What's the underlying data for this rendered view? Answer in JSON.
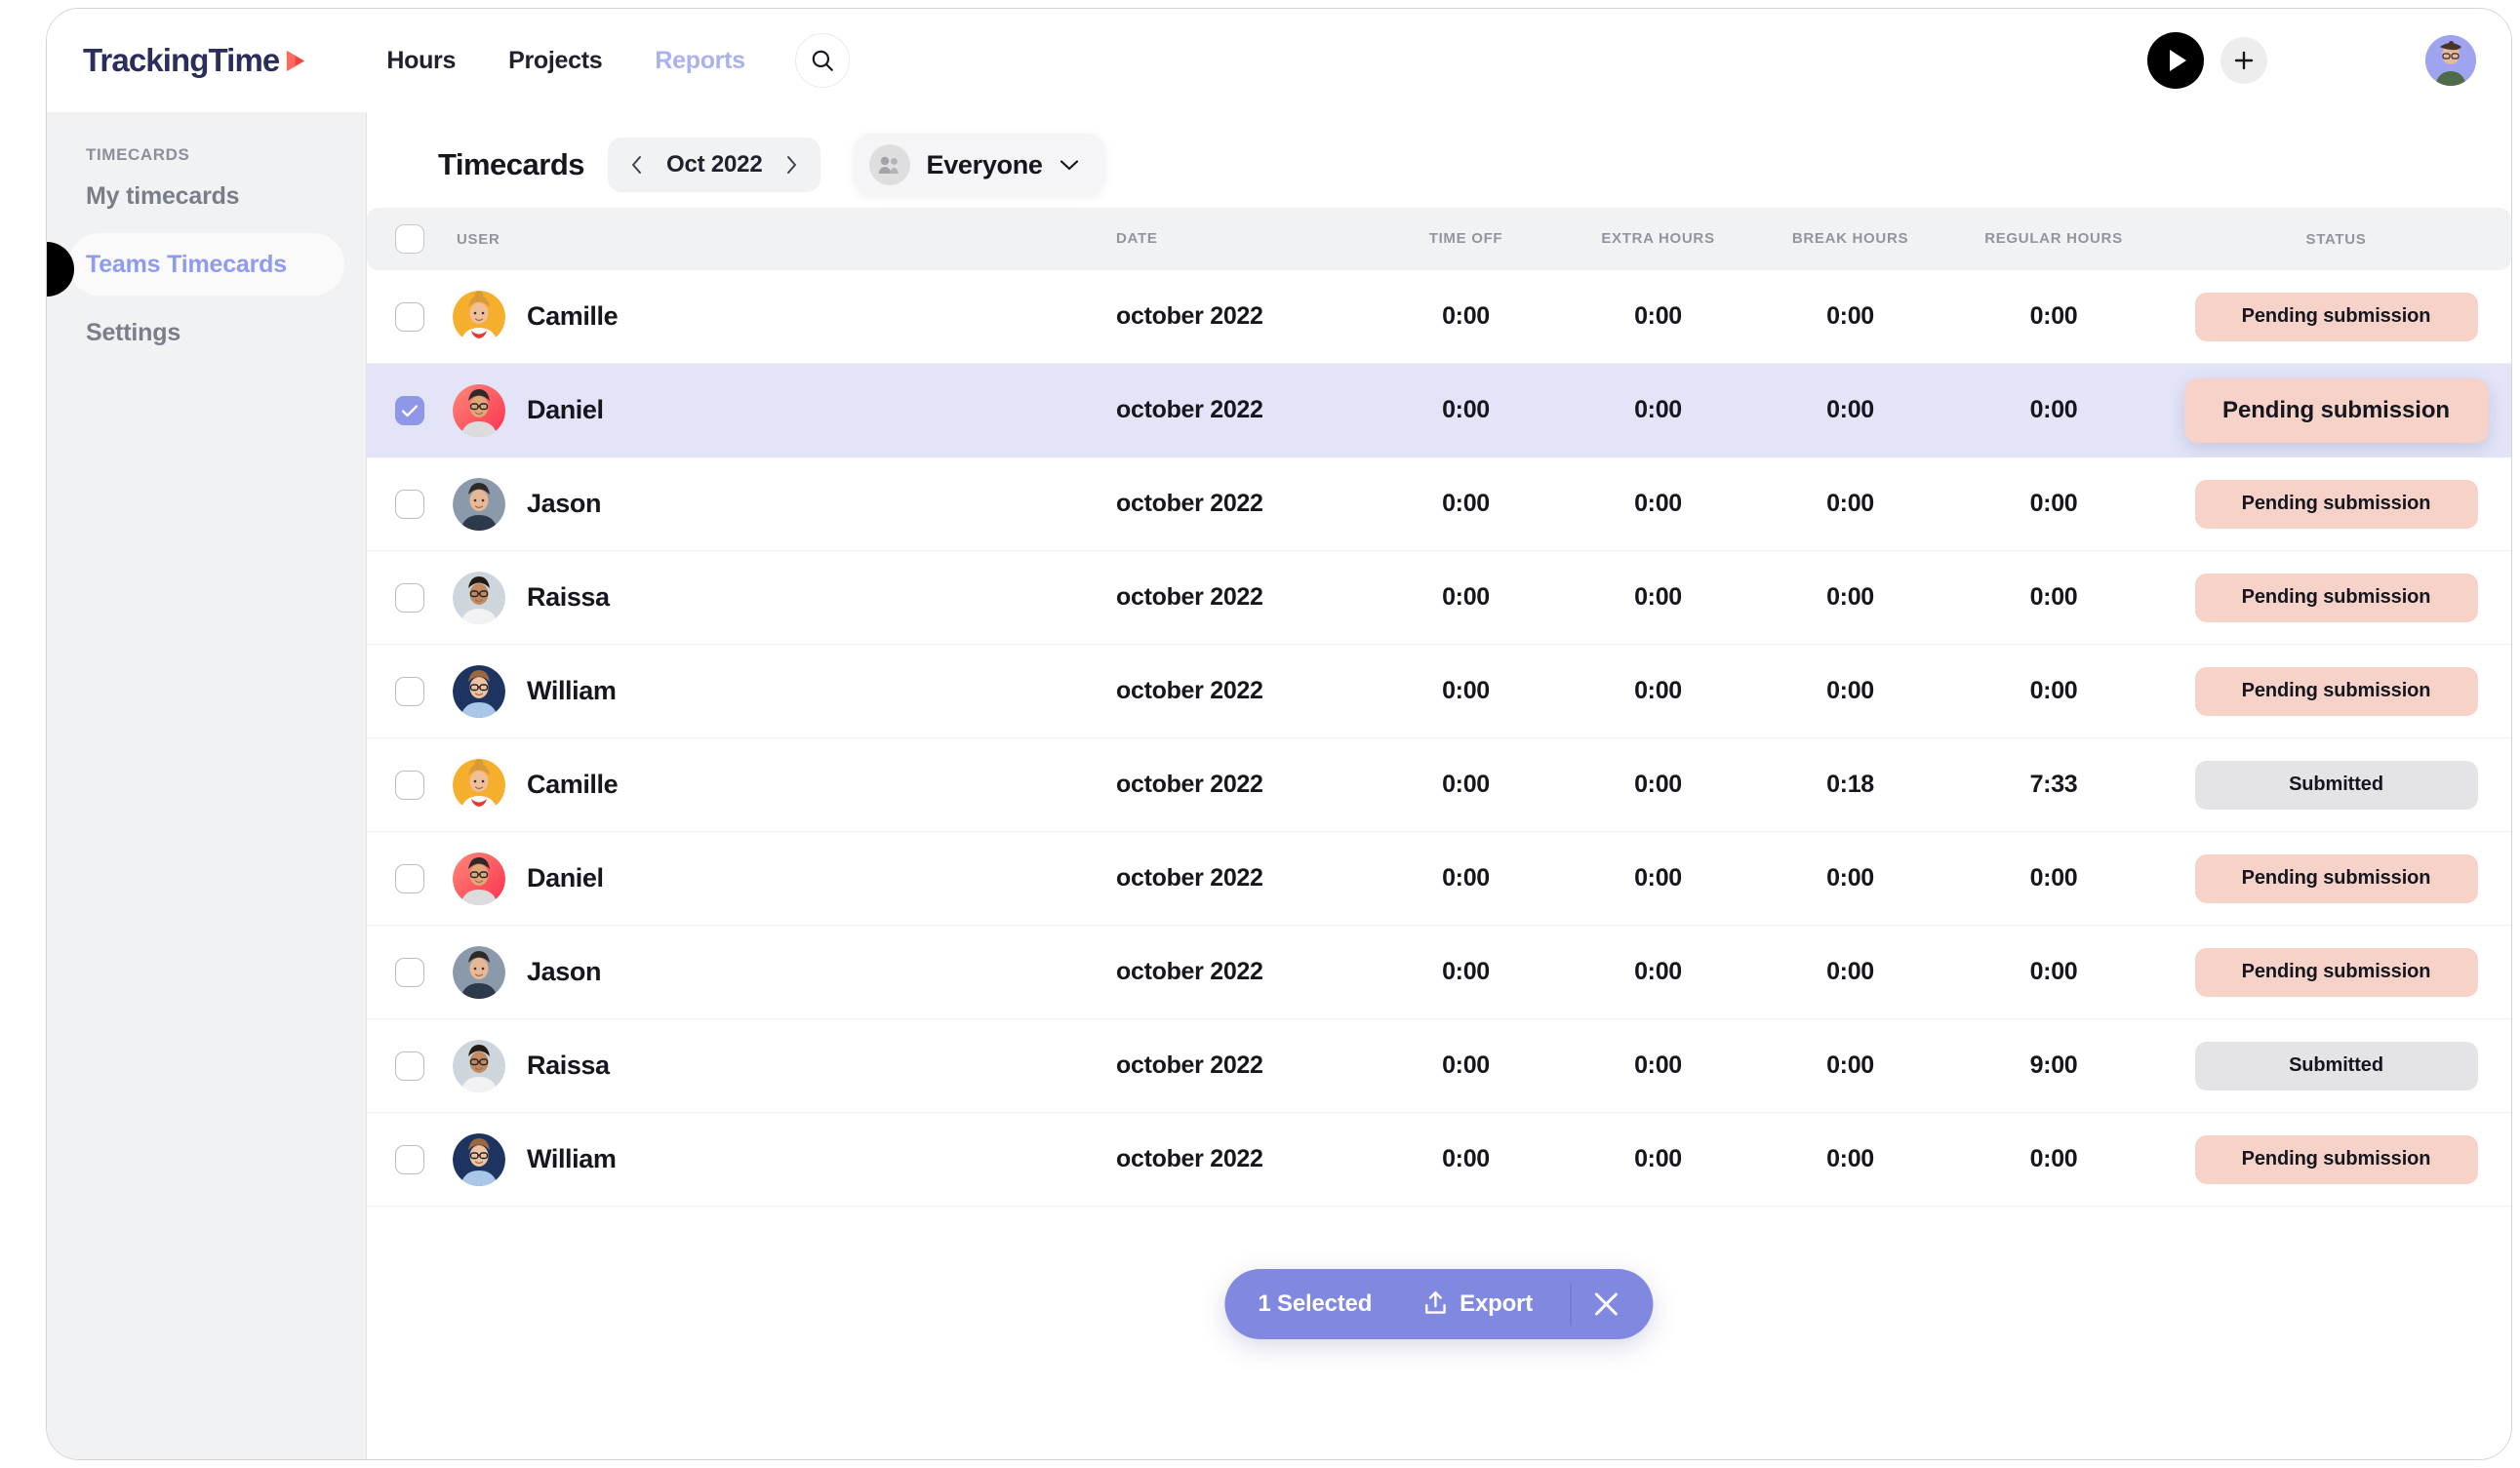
{
  "topbar": {
    "logo_text": "TrackingTime",
    "logo_icon": "play-mark-icon",
    "nav": [
      {
        "label": "Hours",
        "active": false,
        "muted": false
      },
      {
        "label": "Projects",
        "active": false,
        "muted": false
      },
      {
        "label": "Reports",
        "active": true,
        "muted": true
      }
    ],
    "search_icon": "search-icon",
    "play_icon": "play-icon",
    "add_icon": "plus-icon",
    "avatar_icon": "user-avatar"
  },
  "sidebar": {
    "section_label": "TIMECARDS",
    "items": [
      {
        "label": "My timecards",
        "active": false
      },
      {
        "label": "Teams Timecards",
        "active": true
      },
      {
        "label": "Settings",
        "active": false
      }
    ],
    "collapse_icon": "collapse-knob-icon"
  },
  "page": {
    "title": "Timecards",
    "month": "Oct 2022",
    "prev_icon": "chevron-left-icon",
    "next_icon": "chevron-right-icon",
    "filter_label": "Everyone",
    "filter_icon": "people-group-icon",
    "filter_chevron": "chevron-down-icon"
  },
  "table": {
    "columns": [
      "USER",
      "DATE",
      "TIME OFF",
      "EXTRA HOURS",
      "BREAK HOURS",
      "REGULAR HOURS",
      "STATUS"
    ],
    "rows": [
      {
        "user": "Camille",
        "avatar": "avatar-camille",
        "date": "october 2022",
        "time_off": "0:00",
        "extra_hours": "0:00",
        "break_hours": "0:00",
        "regular_hours": "0:00",
        "status": "Pending submission",
        "status_kind": "pending",
        "selected": false,
        "hovered": false
      },
      {
        "user": "Daniel",
        "avatar": "avatar-daniel",
        "date": "october 2022",
        "time_off": "0:00",
        "extra_hours": "0:00",
        "break_hours": "0:00",
        "regular_hours": "0:00",
        "status": "Pending submission",
        "status_kind": "pending",
        "selected": true,
        "hovered": true
      },
      {
        "user": "Jason",
        "avatar": "avatar-jason",
        "date": "october 2022",
        "time_off": "0:00",
        "extra_hours": "0:00",
        "break_hours": "0:00",
        "regular_hours": "0:00",
        "status": "Pending submission",
        "status_kind": "pending",
        "selected": false,
        "hovered": false
      },
      {
        "user": "Raissa",
        "avatar": "avatar-raissa",
        "date": "october 2022",
        "time_off": "0:00",
        "extra_hours": "0:00",
        "break_hours": "0:00",
        "regular_hours": "0:00",
        "status": "Pending submission",
        "status_kind": "pending",
        "selected": false,
        "hovered": false
      },
      {
        "user": "William",
        "avatar": "avatar-william",
        "date": "october 2022",
        "time_off": "0:00",
        "extra_hours": "0:00",
        "break_hours": "0:00",
        "regular_hours": "0:00",
        "status": "Pending submission",
        "status_kind": "pending",
        "selected": false,
        "hovered": false
      },
      {
        "user": "Camille",
        "avatar": "avatar-camille",
        "date": "october 2022",
        "time_off": "0:00",
        "extra_hours": "0:00",
        "break_hours": "0:18",
        "regular_hours": "7:33",
        "status": "Submitted",
        "status_kind": "submitted",
        "selected": false,
        "hovered": false
      },
      {
        "user": "Daniel",
        "avatar": "avatar-daniel",
        "date": "october 2022",
        "time_off": "0:00",
        "extra_hours": "0:00",
        "break_hours": "0:00",
        "regular_hours": "0:00",
        "status": "Pending submission",
        "status_kind": "pending",
        "selected": false,
        "hovered": false
      },
      {
        "user": "Jason",
        "avatar": "avatar-jason",
        "date": "october 2022",
        "time_off": "0:00",
        "extra_hours": "0:00",
        "break_hours": "0:00",
        "regular_hours": "0:00",
        "status": "Pending submission",
        "status_kind": "pending",
        "selected": false,
        "hovered": false
      },
      {
        "user": "Raissa",
        "avatar": "avatar-raissa",
        "date": "october 2022",
        "time_off": "0:00",
        "extra_hours": "0:00",
        "break_hours": "0:00",
        "regular_hours": "9:00",
        "status": "Submitted",
        "status_kind": "submitted",
        "selected": false,
        "hovered": false
      },
      {
        "user": "William",
        "avatar": "avatar-william",
        "date": "october 2022",
        "time_off": "0:00",
        "extra_hours": "0:00",
        "break_hours": "0:00",
        "regular_hours": "0:00",
        "status": "Pending submission",
        "status_kind": "pending",
        "selected": false,
        "hovered": false
      }
    ]
  },
  "action_bar": {
    "selected_label": "1 Selected",
    "export_label": "Export",
    "export_icon": "upload-icon",
    "close_icon": "close-icon"
  },
  "colors": {
    "accent": "#8e97e8",
    "action_bar": "#8188e0",
    "selected_row": "#e3e4f8",
    "pending_badge": "#f6d2c8",
    "submitted_badge": "#e4e4e6",
    "logo_navy": "#2b2e5c",
    "logo_red": "#f9423a",
    "sidebar_bg": "#f1f2f4",
    "muted_nav": "#a9b2ee"
  },
  "avatar_colors": {
    "avatar-camille": "#f6ae2d",
    "avatar-daniel": "#fb4b5c",
    "avatar-jason": "#8b9aab",
    "avatar-raissa": "#cdd6dd",
    "avatar-william": "#1d3461"
  }
}
